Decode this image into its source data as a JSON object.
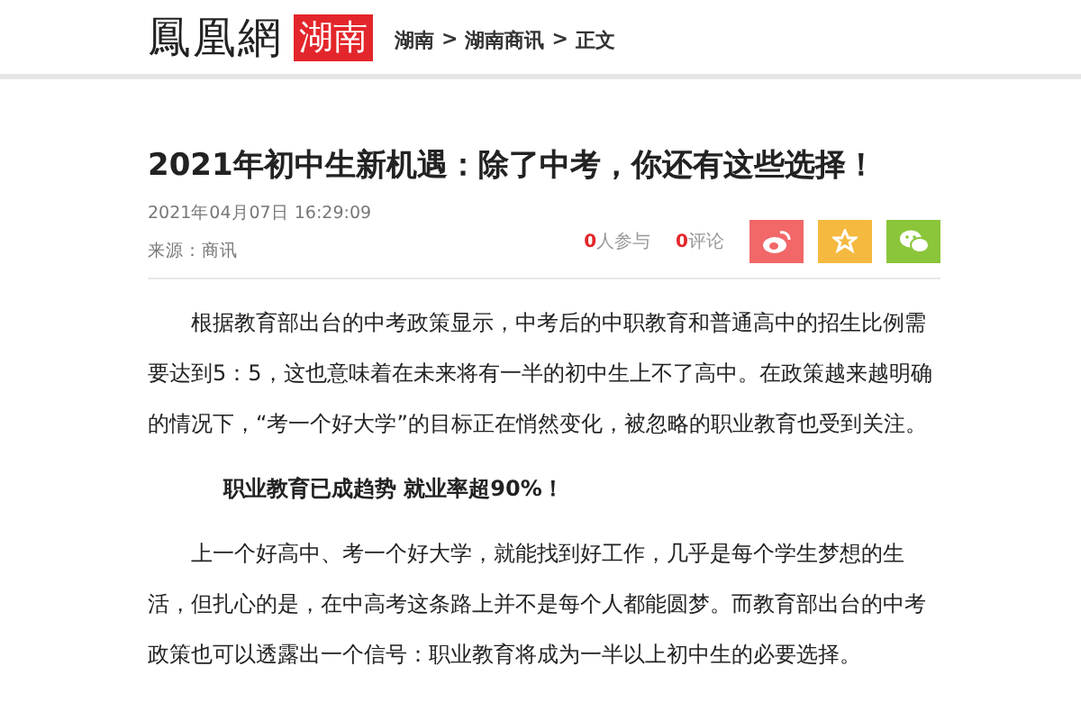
{
  "header": {
    "logo": "鳳凰網",
    "region": "湖南",
    "breadcrumb": [
      {
        "label": "湖南"
      },
      {
        "label": "湖南商讯"
      },
      {
        "label": "正文"
      }
    ],
    "separator": ">"
  },
  "article": {
    "title": "2021年初中生新机遇：除了中考，你还有这些选择！",
    "date": "2021年04月07日 16:29:09",
    "source": "来源：商讯",
    "stats": [
      {
        "count": "0",
        "label": "人参与"
      },
      {
        "count": "0",
        "label": "评论"
      }
    ],
    "share": [
      {
        "kind": "weibo",
        "color": "#f26768"
      },
      {
        "kind": "favorite",
        "color": "#f5b93f"
      },
      {
        "kind": "wechat",
        "color": "#8bc53a"
      }
    ],
    "body": [
      {
        "kind": "paragraph",
        "text": "根据教育部出台的中考政策显示，中考后的中职教育和普通高中的招生比例需要达到5：5，这也意味着在未来将有一半的初中生上不了高中。在政策越来越明确的情况下，“考一个好大学”的目标正在悄然变化，被忽略的职业教育也受到关注。"
      },
      {
        "kind": "heading",
        "text": "职业教育已成趋势 就业率超90%！"
      },
      {
        "kind": "paragraph",
        "text": "上一个好高中、考一个好大学，就能找到好工作，几乎是每个学生梦想的生活，但扎心的是，在中高考这条路上并不是每个人都能圆梦。而教育部出台的中考政策也可以透露出一个信号：职业教育将成为一半以上初中生的必要选择。"
      }
    ]
  }
}
